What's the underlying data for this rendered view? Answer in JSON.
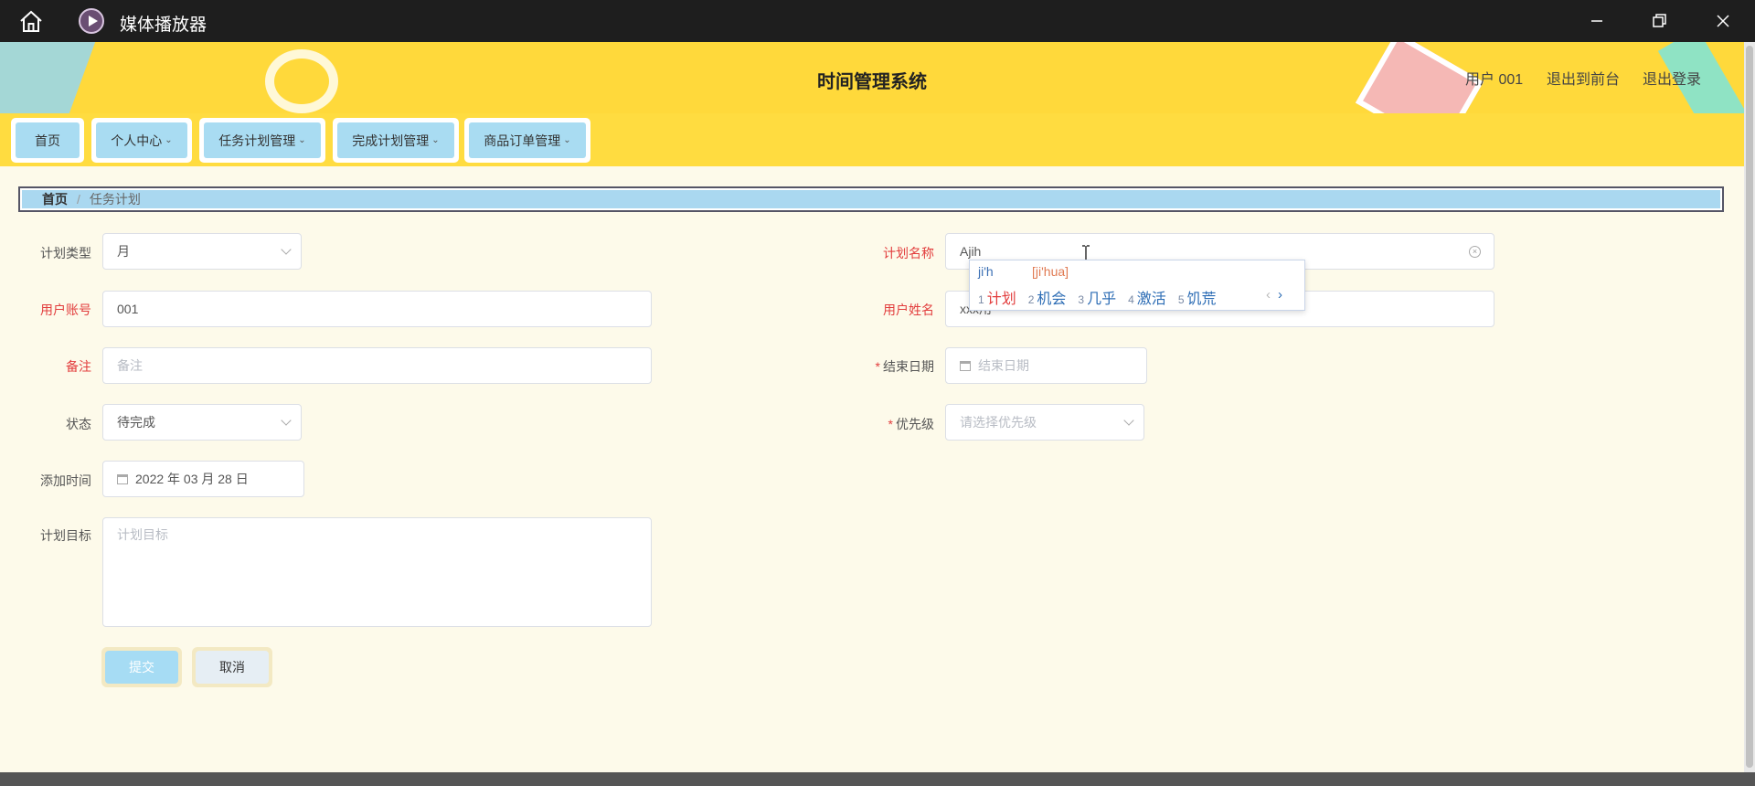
{
  "window": {
    "title": "媒体播放器"
  },
  "header": {
    "system_title": "时间管理系统",
    "user_label": "用户 001",
    "exit_front_label": "退出到前台",
    "logout_label": "退出登录"
  },
  "nav": {
    "items": [
      {
        "label": "首页"
      },
      {
        "label": "个人中心"
      },
      {
        "label": "任务计划管理"
      },
      {
        "label": "完成计划管理"
      },
      {
        "label": "商品订单管理"
      }
    ]
  },
  "breadcrumb": {
    "home": "首页",
    "current": "任务计划"
  },
  "form": {
    "plan_type": {
      "label": "计划类型",
      "value": "月"
    },
    "plan_name": {
      "label": "计划名称",
      "value": "Ajih"
    },
    "user_account": {
      "label": "用户账号",
      "value": "001"
    },
    "user_name": {
      "label": "用户姓名",
      "value": "xxx用"
    },
    "remark": {
      "label": "备注",
      "placeholder": "备注"
    },
    "end_date": {
      "label": "结束日期",
      "placeholder": "结束日期"
    },
    "status": {
      "label": "状态",
      "value": "待完成"
    },
    "priority": {
      "label": "优先级",
      "placeholder": "请选择优先级"
    },
    "add_time": {
      "label": "添加时间",
      "value": "2022 年 03 月 28 日"
    },
    "plan_goal": {
      "label": "计划目标",
      "placeholder": "计划目标"
    },
    "submit_label": "提交",
    "cancel_label": "取消"
  },
  "ime": {
    "composition": "ji'h",
    "pinyin_hint": "[ji'hua]",
    "candidates": [
      {
        "n": "1",
        "text": "计划"
      },
      {
        "n": "2",
        "text": "机会"
      },
      {
        "n": "3",
        "text": "几乎"
      },
      {
        "n": "4",
        "text": "激活"
      },
      {
        "n": "5",
        "text": "饥荒"
      }
    ],
    "prev": "‹",
    "next": "›"
  }
}
